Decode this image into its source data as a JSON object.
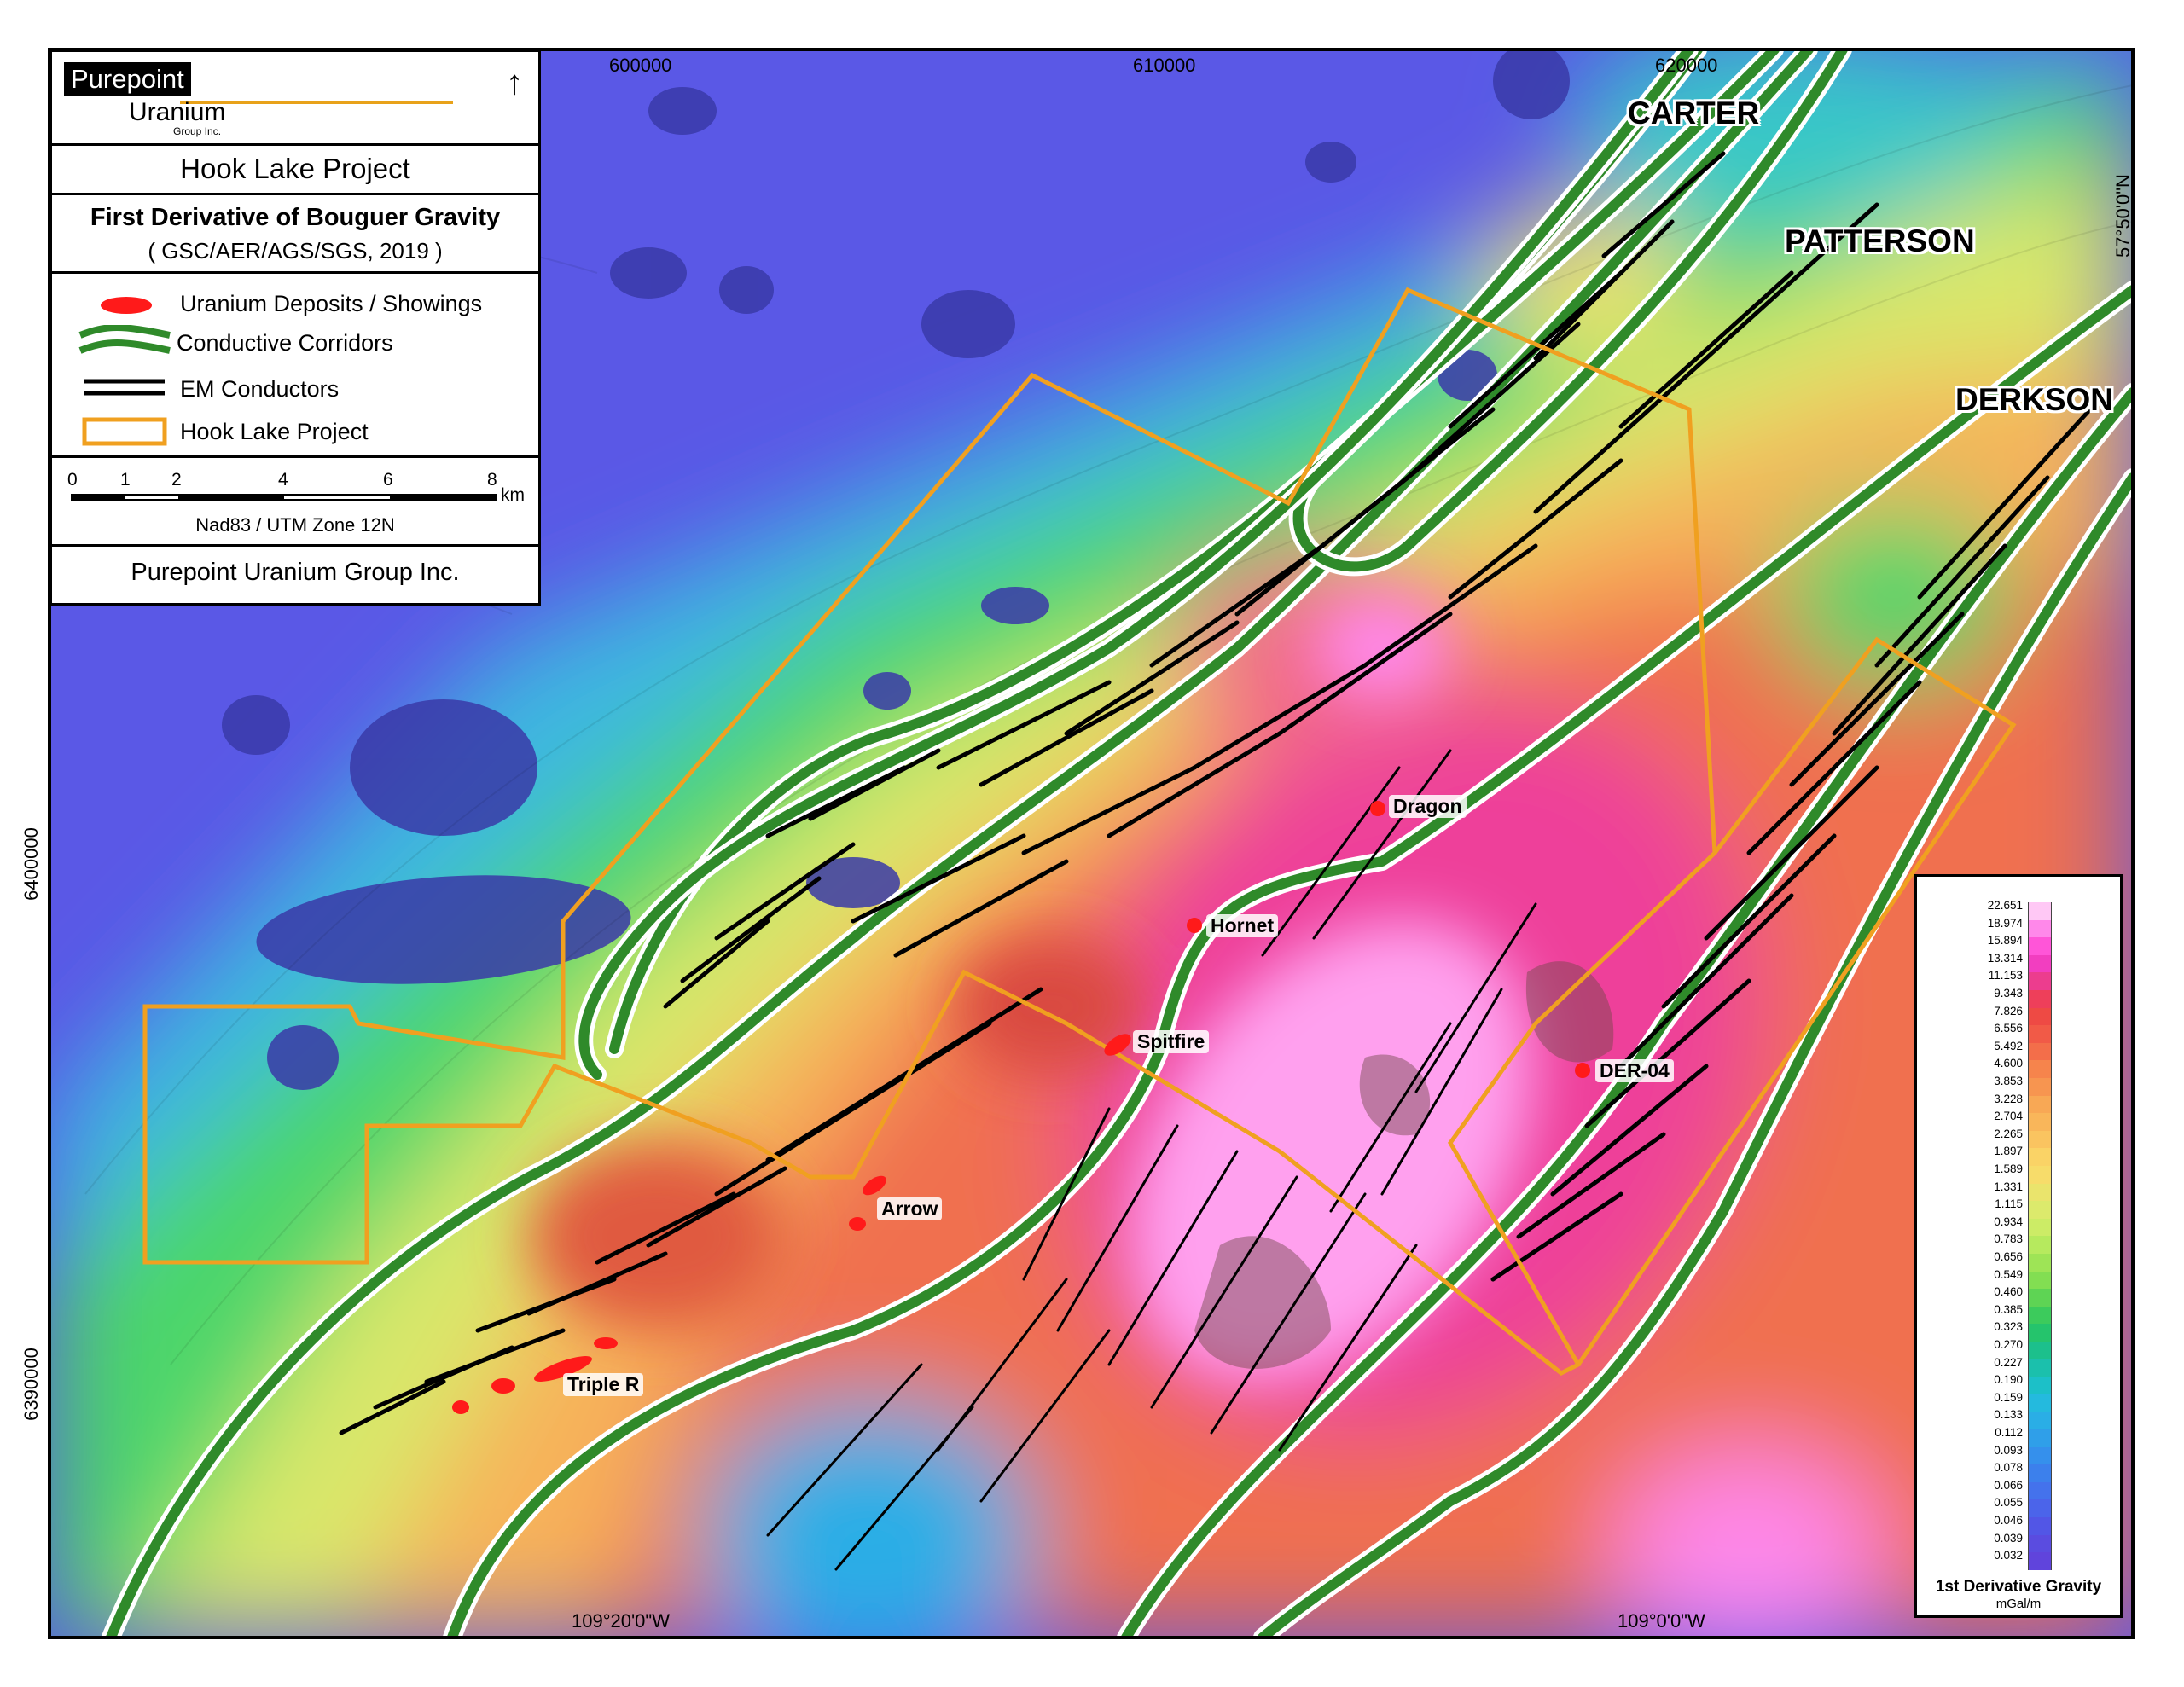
{
  "legend": {
    "logo_line1": "Purepoint",
    "logo_line2": "Uranium",
    "logo_line3": "Group Inc.",
    "north_arrow": "north-arrow-icon",
    "project_title": "Hook Lake Project",
    "map_title": "First Derivative of Bouguer Gravity",
    "map_source": "( GSC/AER/AGS/SGS, 2019 )",
    "items": [
      {
        "label": "Uranium Deposits / Showings",
        "symbol": "red-blob-icon",
        "color": "#ff1a1a"
      },
      {
        "label": "Conductive Corridors",
        "symbol": "green-double-line-icon",
        "color": "#2e8b2e"
      },
      {
        "label": "EM Conductors",
        "symbol": "black-double-line-icon",
        "color": "#000000"
      },
      {
        "label": "Hook Lake Project",
        "symbol": "orange-rectangle-icon",
        "color": "#f0a020"
      }
    ],
    "scale_ticks": [
      "0",
      "1",
      "2",
      "4",
      "6",
      "8"
    ],
    "scale_unit": "km",
    "datum": "Nad83 / UTM Zone 12N",
    "footer": "Purepoint Uranium Group Inc."
  },
  "grid_labels": {
    "easting": [
      "600000",
      "610000",
      "620000"
    ],
    "northing": [
      "6400000",
      "6390000"
    ],
    "longitude": [
      "109°20'0\"W",
      "109°0'0\"W"
    ],
    "latitude": [
      "57°50'0\"N"
    ]
  },
  "corridors": [
    "CARTER",
    "PATTERSON",
    "DERKSON"
  ],
  "deposits": [
    "Dragon",
    "Hornet",
    "Spitfire",
    "Arrow",
    "Triple R",
    "DER-04"
  ],
  "color_scale": {
    "title": "1st Derivative Gravity",
    "unit": "mGal/m",
    "values": [
      "22.651",
      "18.974",
      "15.894",
      "13.314",
      "11.153",
      "9.343",
      "7.826",
      "6.556",
      "5.492",
      "4.600",
      "3.853",
      "3.228",
      "2.704",
      "2.265",
      "1.897",
      "1.589",
      "1.331",
      "1.115",
      "0.934",
      "0.783",
      "0.656",
      "0.549",
      "0.460",
      "0.385",
      "0.323",
      "0.270",
      "0.227",
      "0.190",
      "0.159",
      "0.133",
      "0.112",
      "0.093",
      "0.078",
      "0.066",
      "0.055",
      "0.046",
      "0.039",
      "0.032"
    ],
    "colors": [
      "#ffc8f5",
      "#ff88ea",
      "#ff55d8",
      "#f23ec0",
      "#ec3d8e",
      "#ee3f5a",
      "#ee4a44",
      "#f15a47",
      "#f36e4a",
      "#f6844c",
      "#f79550",
      "#f8a855",
      "#f9b65a",
      "#fac460",
      "#fad366",
      "#f7dc6a",
      "#eae46c",
      "#dcea6c",
      "#ccec66",
      "#b6ea5e",
      "#9ee456",
      "#82de52",
      "#5ed454",
      "#3ccb5c",
      "#25c46c",
      "#1cc08c",
      "#1bc0ac",
      "#1cc0c8",
      "#24bade",
      "#2aaee6",
      "#2f9fe9",
      "#3590ec",
      "#3c80ec",
      "#4472ec",
      "#4b64ea",
      "#5256e6",
      "#5a4ce0",
      "#6044dc"
    ]
  }
}
